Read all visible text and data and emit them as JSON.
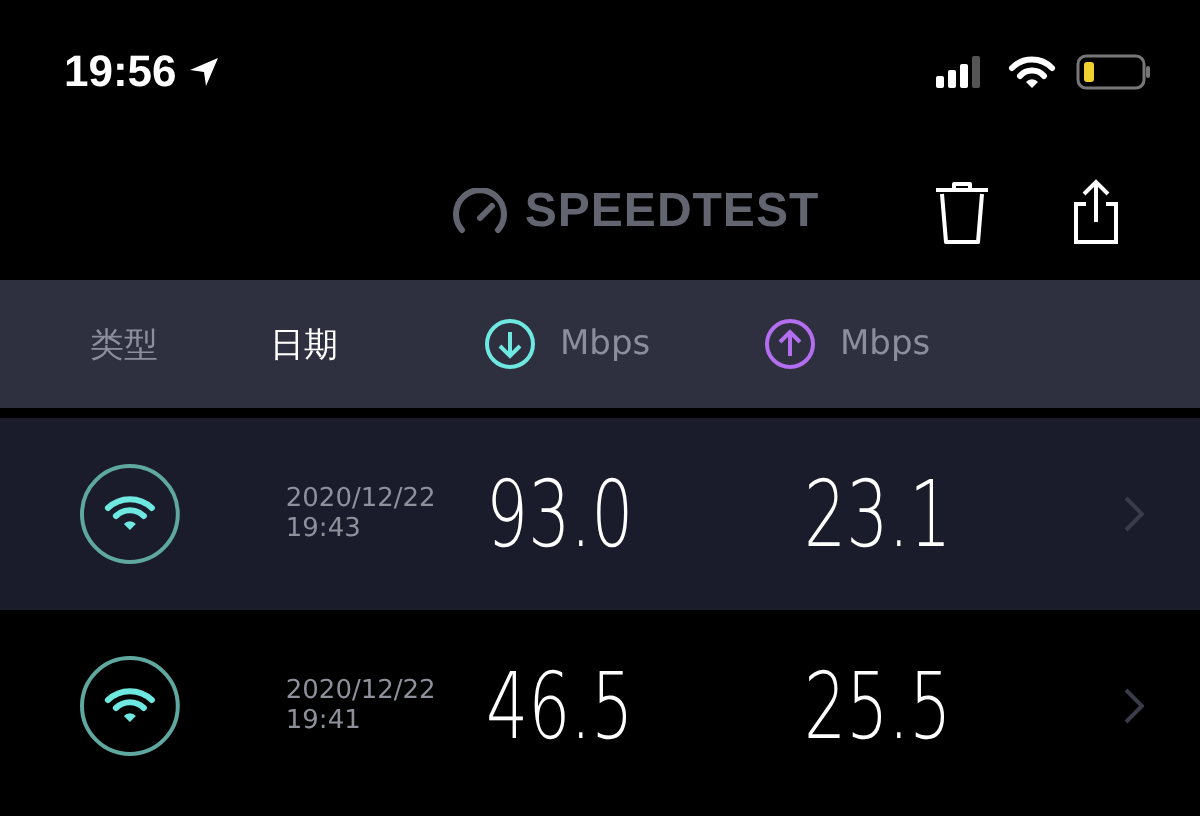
{
  "status_bar": {
    "time": "19:56"
  },
  "header": {
    "logo": "SPEEDTEST"
  },
  "columns": [
    {
      "kind": "text",
      "label": "类型",
      "selected": false
    },
    {
      "kind": "text",
      "label": "日期",
      "selected": true
    },
    {
      "kind": "download",
      "label": "Mbps",
      "selected": false
    },
    {
      "kind": "upload",
      "label": "Mbps",
      "selected": false
    }
  ],
  "results": [
    {
      "date": "2020/12/22",
      "time": "19:43",
      "download": "93.0",
      "upload": "23.1",
      "selected": true
    },
    {
      "date": "2020/12/22",
      "time": "19:41",
      "download": "46.5",
      "upload": "25.5",
      "selected": false
    }
  ]
}
